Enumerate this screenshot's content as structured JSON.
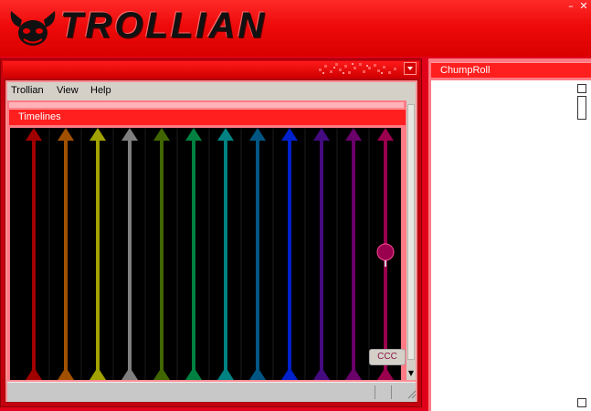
{
  "app": {
    "logo_text": "TROLLIAN",
    "window_buttons": {
      "minimize": "–",
      "close": "✕"
    }
  },
  "menu": {
    "items": [
      "Trollian",
      "View",
      "Help"
    ]
  },
  "timelines": {
    "title": "Timelines",
    "lane_colors": [
      "#a10000",
      "#a15000",
      "#a1a100",
      "#7f7f7f",
      "#416600",
      "#008141",
      "#008282",
      "#005682",
      "#0021cb",
      "#440a7f",
      "#6a006a",
      "#99004d"
    ],
    "marker": {
      "lane_index": 11,
      "label": "CCC",
      "color": "#99004d"
    }
  },
  "chumproll": {
    "title": "ChumpRoll",
    "entries": []
  },
  "colors": {
    "brand_red": "#e0001a",
    "title_red": "#ff1f1f",
    "pink": "#ff7b85"
  }
}
